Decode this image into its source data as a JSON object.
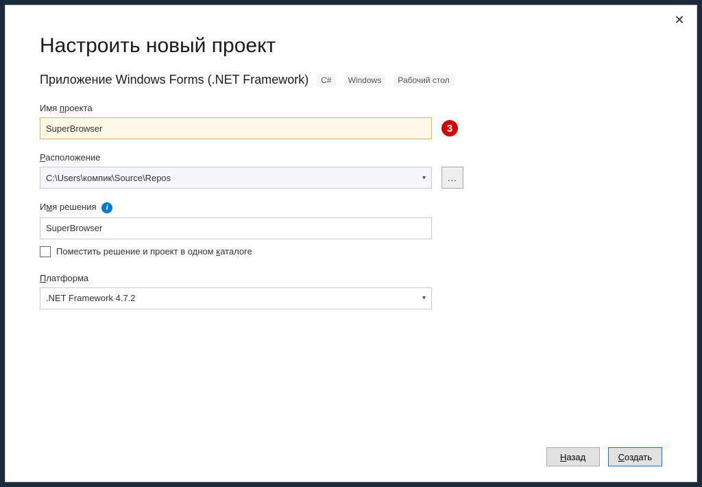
{
  "window": {
    "title": "Настроить новый проект",
    "subtitle": "Приложение Windows Forms (.NET Framework)",
    "tags": [
      "C#",
      "Windows",
      "Рабочий стол"
    ],
    "close": "✕"
  },
  "fields": {
    "projectName": {
      "label_pre": "Имя ",
      "label_u": "п",
      "label_post": "роекта",
      "value": "SuperBrowser"
    },
    "location": {
      "label_u": "Р",
      "label_post": "асположение",
      "value": "C:\\Users\\компик\\Source\\Repos",
      "browseLabel": "..."
    },
    "solutionName": {
      "label_pre": "И",
      "label_u": "м",
      "label_post": "я решения",
      "value": "SuperBrowser",
      "info": "i"
    },
    "sameDirectory": {
      "label_pre": "Поместить решение и проект в одном ",
      "label_u": "к",
      "label_post": "аталоге"
    },
    "framework": {
      "label_u": "П",
      "label_post": "латформа",
      "value": ".NET Framework 4.7.2"
    }
  },
  "callout": "3",
  "footer": {
    "back_u": "Н",
    "back_post": "азад",
    "create_u": "С",
    "create_post": "оздать"
  }
}
